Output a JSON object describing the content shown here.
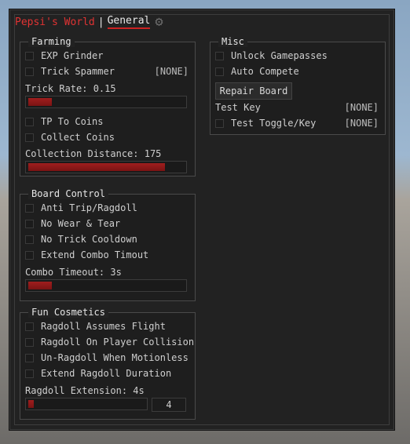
{
  "window": {
    "brand": "Pepsi's World",
    "separator": "|",
    "tab": "General",
    "settings_icon": "gear-icon"
  },
  "farming": {
    "title": "Farming",
    "exp_grinder": "EXP Grinder",
    "trick_spammer": "Trick Spammer",
    "trick_spammer_key": "[NONE]",
    "trick_rate_label": "Trick Rate: 0.15",
    "trick_rate_fraction": 0.15,
    "tp_to_coins": "TP To Coins",
    "collect_coins": "Collect Coins",
    "collection_distance_label": "Collection Distance: 175",
    "collection_distance_fraction": 0.88
  },
  "board_control": {
    "title": "Board Control",
    "anti_trip": "Anti Trip/Ragdoll",
    "no_wear": "No Wear & Tear",
    "no_trick_cooldown": "No Trick Cooldown",
    "extend_combo": "Extend Combo Timout",
    "combo_timeout_label": "Combo Timeout: 3s",
    "combo_timeout_fraction": 0.15
  },
  "fun_cosmetics": {
    "title": "Fun Cosmetics",
    "ragdoll_flight": "Ragdoll Assumes Flight",
    "ragdoll_collision": "Ragdoll On Player Collision",
    "unragdoll_motionless": "Un-Ragdoll When Motionless",
    "extend_ragdoll": "Extend Ragdoll Duration",
    "ragdoll_extension_label": "Ragdoll Extension: 4s",
    "ragdoll_extension_fraction": 0.05,
    "ragdoll_extension_value": "4"
  },
  "misc": {
    "title": "Misc",
    "unlock_gamepasses": "Unlock Gamepasses",
    "auto_compete": "Auto Compete",
    "repair_board": "Repair Board",
    "test_key": "Test Key",
    "test_key_value": "[NONE]",
    "test_toggle": "Test Toggle/Key",
    "test_toggle_key": "[NONE]"
  },
  "colors": {
    "accent": "#c22222",
    "panel": "#222222",
    "text": "#cfcfcf"
  }
}
